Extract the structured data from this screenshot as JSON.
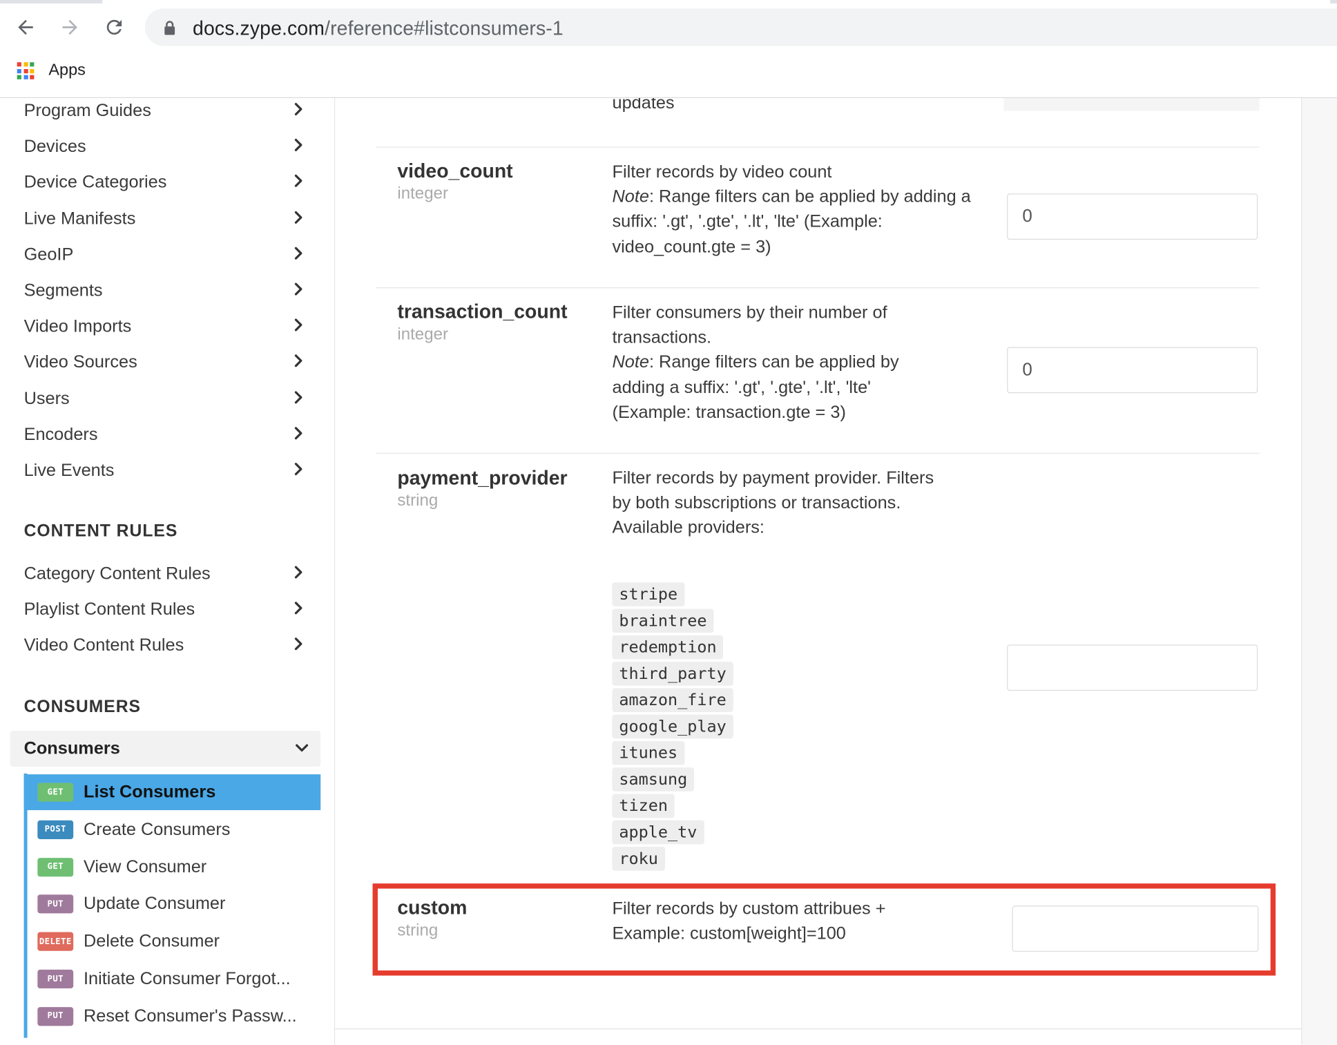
{
  "browser": {
    "url_host": "docs.zype.com",
    "url_path": "/reference#listconsumers-1",
    "bookmarks": [
      {
        "label": "Apps"
      }
    ],
    "apps_icon_colors": [
      "#ea4335",
      "#fbbc05",
      "#34a853",
      "#4285f4",
      "#ea4335",
      "#fbbc05",
      "#34a853",
      "#4285f4",
      "#ea4335"
    ]
  },
  "sidebar": {
    "items": [
      {
        "label": "Program Guides"
      },
      {
        "label": "Devices"
      },
      {
        "label": "Device Categories"
      },
      {
        "label": "Live Manifests"
      },
      {
        "label": "GeoIP"
      },
      {
        "label": "Segments"
      },
      {
        "label": "Video Imports"
      },
      {
        "label": "Video Sources"
      },
      {
        "label": "Users"
      },
      {
        "label": "Encoders"
      },
      {
        "label": "Live Events"
      }
    ],
    "content_rules_heading": "CONTENT RULES",
    "content_rules_items": [
      {
        "label": "Category Content Rules"
      },
      {
        "label": "Playlist Content Rules"
      },
      {
        "label": "Video Content Rules"
      }
    ],
    "consumers_heading": "CONSUMERS",
    "consumers_group": "Consumers",
    "endpoints": [
      {
        "method": "GET",
        "label": "List Consumers",
        "active": true,
        "color": "#6fbf73"
      },
      {
        "method": "POST",
        "label": "Create Consumers",
        "color": "#3b8bbf"
      },
      {
        "method": "GET",
        "label": "View Consumer",
        "color": "#6fbf73"
      },
      {
        "method": "PUT",
        "label": "Update Consumer",
        "color": "#a07a9c"
      },
      {
        "method": "DELETE",
        "label": "Delete Consumer",
        "color": "#e06a5c"
      },
      {
        "method": "PUT",
        "label": "Initiate Consumer Forgot...",
        "color": "#a07a9c"
      },
      {
        "method": "PUT",
        "label": "Reset Consumer's Passw...",
        "color": "#a07a9c"
      }
    ],
    "active_color": "#4aa8e6"
  },
  "params": {
    "prev_tail": "updates",
    "video_count": {
      "name": "video_count",
      "type": "integer",
      "desc_line1": "Filter records by video count",
      "note_label": "Note",
      "note_text": ": Range filters can be applied by adding a suffix: '.gt', '.gte', '.lt', 'lte' (Example: video_count.gte = 3)",
      "value": "0"
    },
    "transaction_count": {
      "name": "transaction_count",
      "type": "integer",
      "desc_line1": "Filter consumers by their number of transactions.",
      "note_label": "Note",
      "note_text": ": Range filters can be applied by adding a suffix: '.gt', '.gte', '.lt', 'lte' (Example: transaction.gte = 3)",
      "value": "0"
    },
    "payment_provider": {
      "name": "payment_provider",
      "type": "string",
      "desc": "Filter records by payment provider. Filters by both subscriptions or transactions.",
      "desc_available": "Available providers:",
      "providers": [
        "stripe",
        "braintree",
        "redemption",
        "third_party",
        "amazon_fire",
        "google_play",
        "itunes",
        "samsung",
        "tizen",
        "apple_tv",
        "roku"
      ],
      "value": ""
    },
    "custom": {
      "name": "custom",
      "type": "string",
      "desc_line1": "Filter records by custom attribues +",
      "desc_line2": "Example: custom[weight]=100",
      "value": ""
    }
  },
  "highlight_color": "#e53c2d"
}
